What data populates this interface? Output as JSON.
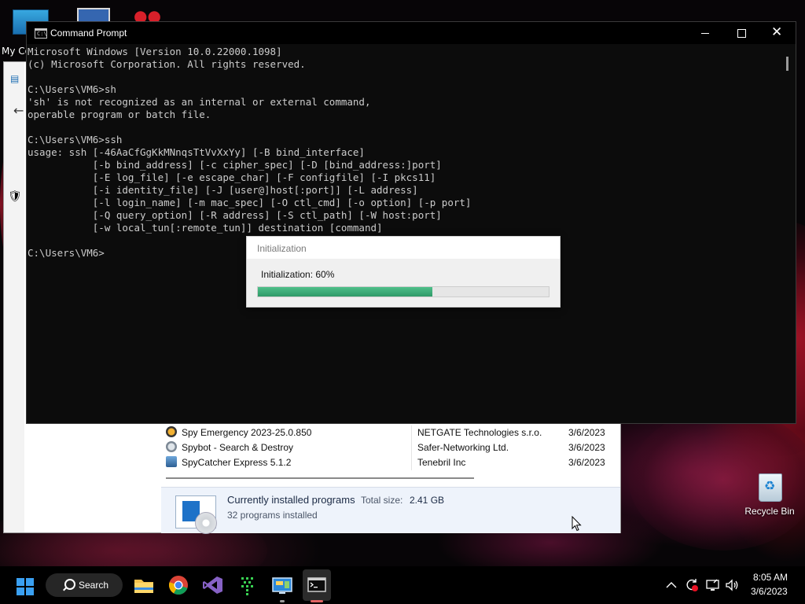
{
  "desktop": {
    "icon_label_partial": "My Co",
    "recycle_bin_label": "Recycle Bin"
  },
  "programs_window": {
    "rows": [
      {
        "name": "Spy Emergency 2023-25.0.850",
        "publisher": "NETGATE Technologies s.r.o.",
        "date": "3/6/2023"
      },
      {
        "name": "Spybot - Search & Destroy",
        "publisher": "Safer-Networking Ltd.",
        "date": "3/6/2023"
      },
      {
        "name": "SpyCatcher Express 5.1.2",
        "publisher": "Tenebril Inc",
        "date": "3/6/2023"
      }
    ],
    "summary": {
      "title": "Currently installed programs",
      "total_size_label": "Total size:",
      "total_size": "2.41 GB",
      "count": "32 programs installed"
    }
  },
  "cmd": {
    "title": "Command Prompt",
    "lines": [
      "Microsoft Windows [Version 10.0.22000.1098]",
      "(c) Microsoft Corporation. All rights reserved.",
      "",
      "C:\\Users\\VM6>sh",
      "'sh' is not recognized as an internal or external command,",
      "operable program or batch file.",
      "",
      "C:\\Users\\VM6>ssh",
      "usage: ssh [-46AaCfGgKkMNnqsTtVvXxYy] [-B bind_interface]",
      "           [-b bind_address] [-c cipher_spec] [-D [bind_address:]port]",
      "           [-E log_file] [-e escape_char] [-F configfile] [-I pkcs11]",
      "           [-i identity_file] [-J [user@]host[:port]] [-L address]",
      "           [-l login_name] [-m mac_spec] [-O ctl_cmd] [-o option] [-p port]",
      "           [-Q query_option] [-R address] [-S ctl_path] [-W host:port]",
      "           [-w local_tun[:remote_tun]] destination [command]",
      "",
      "C:\\Users\\VM6>"
    ]
  },
  "init_dialog": {
    "title": "Initialization",
    "message": "Initialization: 60%",
    "progress_percent": 60
  },
  "taskbar": {
    "search_label": "Search",
    "apps": [
      "start-icon",
      "file-explorer-icon",
      "chrome-icon",
      "visual-studio-icon",
      "grid-app-icon",
      "control-panel-icon",
      "command-prompt-icon"
    ],
    "time": "8:05 AM",
    "date": "3/6/2023"
  },
  "colors": {
    "progress_fill": "#2f9a68",
    "taskbar_bg": "#000000",
    "console_text": "#cccccc",
    "windows_blue": "#3aa0f2"
  }
}
